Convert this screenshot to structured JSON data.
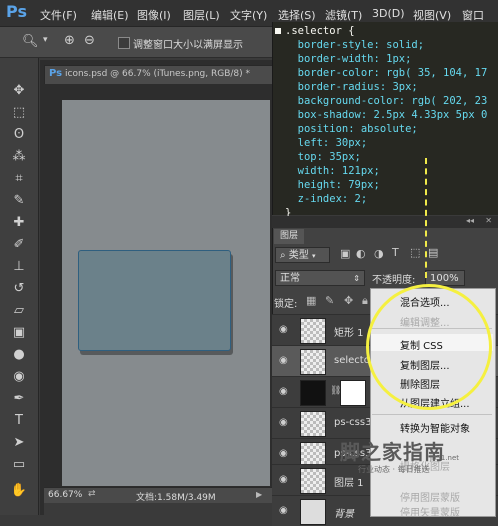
{
  "menubar": {
    "logo": "Ps",
    "items": [
      "文件(F)",
      "编辑(E)",
      "图像(I)",
      "图层(L)",
      "文字(Y)",
      "选择(S)",
      "滤镜(T)",
      "3D(D)",
      "视图(V)",
      "窗口"
    ]
  },
  "options": {
    "checkbox_label": "调整窗口大小以满屏显示"
  },
  "document": {
    "tab_title": "icons.psd @ 66.7% (iTunes.png, RGB/8) *",
    "zoom": "66.67%",
    "doc_info": "文档:1.58M/3.49M"
  },
  "code": {
    "lines": [
      ".selector {",
      "  border-style: solid;",
      "  border-width: 1px;",
      "  border-color: rgb( 35, 104, 17",
      "  border-radius: 3px;",
      "  background-color: rgb( 202, 23",
      "  box-shadow: 2.5px 4.33px 5px 0",
      "  position: absolute;",
      "  left: 30px;",
      "  top: 35px;",
      "  width: 121px;",
      "  height: 79px;",
      "  z-index: 2;",
      "}"
    ]
  },
  "layers_panel": {
    "tab": "图层",
    "filter_kind": "类型",
    "blend_mode": "正常",
    "opacity_label": "不透明度:",
    "opacity_value": "100%",
    "lock_label": "锁定:",
    "layers": [
      {
        "name": "矩形 1",
        "selected": false
      },
      {
        "name": "selector",
        "selected": true
      },
      {
        "name": "",
        "selected": false
      },
      {
        "name": "ps-css3",
        "selected": false
      },
      {
        "name": "ps-css3",
        "selected": false
      },
      {
        "name": "图层 1",
        "selected": false
      },
      {
        "name": "背景",
        "selected": false
      }
    ]
  },
  "context_menu": {
    "items": [
      {
        "label": "混合选项...",
        "disabled": false
      },
      {
        "label": "编辑调整...",
        "disabled": true
      },
      {
        "label": "复制 CSS",
        "disabled": false,
        "highlighted": true
      },
      {
        "label": "复制图层...",
        "disabled": false
      },
      {
        "label": "删除图层",
        "disabled": false
      },
      {
        "label": "从图层建立组...",
        "disabled": false
      },
      {
        "label": "转换为智能对象",
        "disabled": false
      },
      {
        "label": "栅格化图层",
        "disabled": true
      },
      {
        "label": "停用图层蒙版",
        "disabled": true
      },
      {
        "label": "停用矢量蒙版",
        "disabled": true
      }
    ]
  },
  "watermark": {
    "title": "脚之家指南",
    "sub": "行业动态 · 每日推送",
    "url": "jb51.net"
  },
  "colors": {
    "highlight_circle": "#f5f040",
    "code_keyword": "#66d9ef",
    "ps_blue": "#5aa3e8"
  }
}
